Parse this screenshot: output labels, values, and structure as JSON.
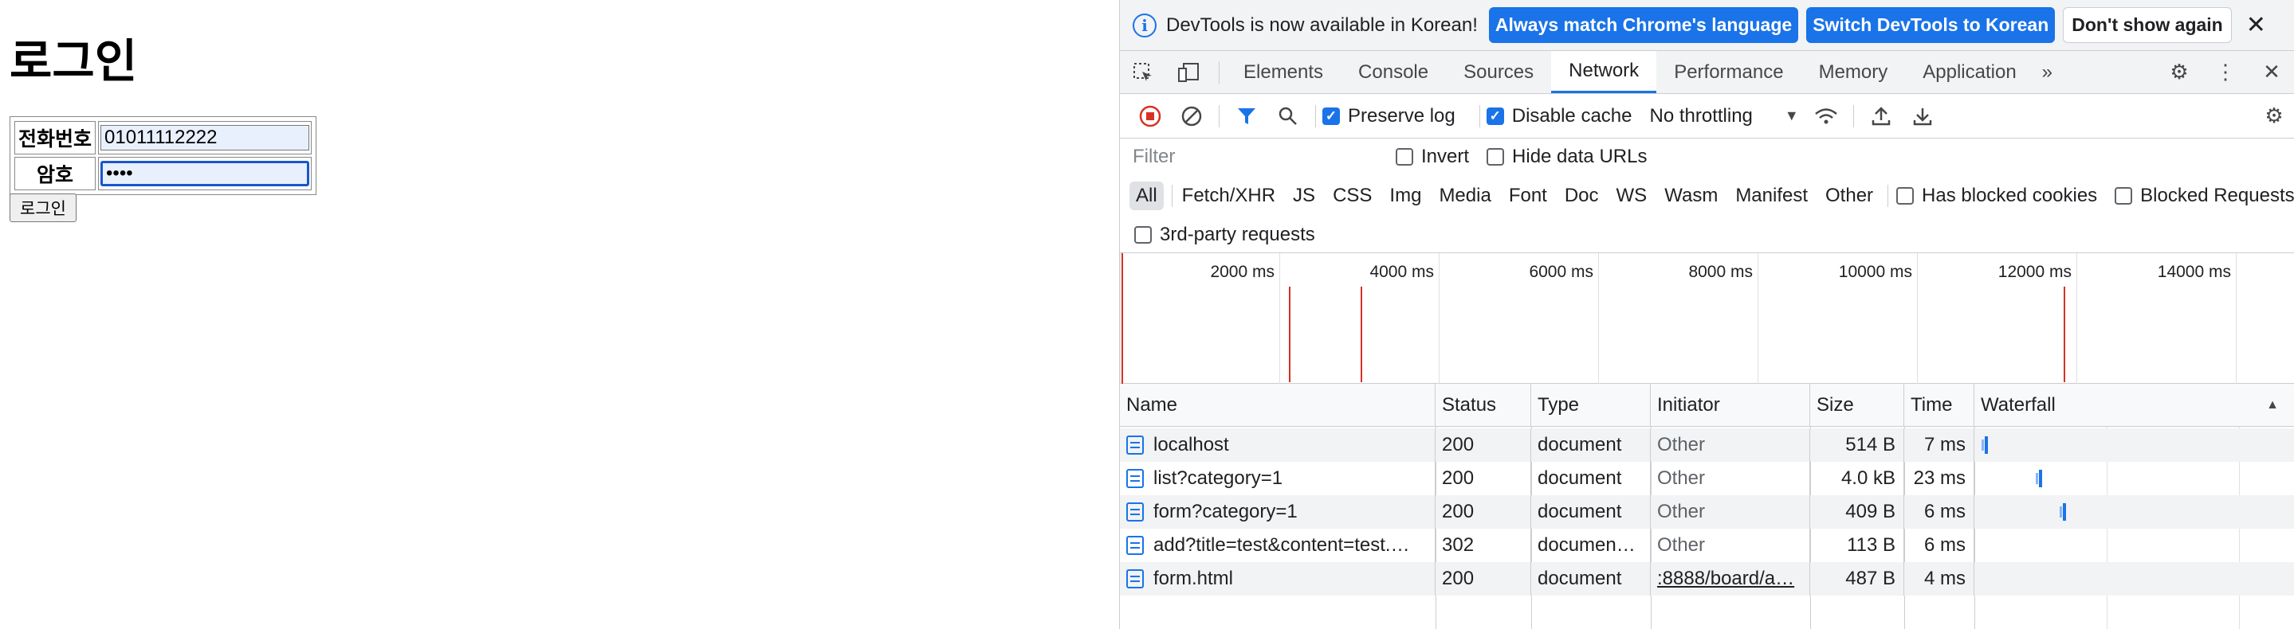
{
  "page": {
    "title": "로그인",
    "phone_label": "전화번호",
    "phone_value": "01011112222",
    "password_label": "암호",
    "password_value": "••••",
    "login_button": "로그인"
  },
  "devtools": {
    "infobar": {
      "message": "DevTools is now available in Korean!",
      "btn_match": "Always match Chrome's language",
      "btn_switch": "Switch DevTools to Korean",
      "btn_dismiss": "Don't show again",
      "close": "✕"
    },
    "tabs": [
      "Elements",
      "Console",
      "Sources",
      "Network",
      "Performance",
      "Memory",
      "Application"
    ],
    "active_tab": "Network",
    "more_tabs": "»",
    "toolbar": {
      "preserve_log": "Preserve log",
      "disable_cache": "Disable cache",
      "throttling": "No throttling"
    },
    "filter": {
      "placeholder": "Filter",
      "invert": "Invert",
      "hide_data_urls": "Hide data URLs"
    },
    "types": [
      "All",
      "Fetch/XHR",
      "JS",
      "CSS",
      "Img",
      "Media",
      "Font",
      "Doc",
      "WS",
      "Wasm",
      "Manifest",
      "Other"
    ],
    "has_blocked_cookies": "Has blocked cookies",
    "blocked_requests": "Blocked Requests",
    "third_party": "3rd-party requests",
    "overview_ticks": [
      "2000 ms",
      "4000 ms",
      "6000 ms",
      "8000 ms",
      "10000 ms",
      "12000 ms",
      "14000 ms"
    ],
    "columns": [
      "Name",
      "Status",
      "Type",
      "Initiator",
      "Size",
      "Time",
      "Waterfall"
    ],
    "rows": [
      {
        "name": "localhost",
        "status": "200",
        "type": "document",
        "initiator": "Other",
        "size": "514 B",
        "time": "7 ms"
      },
      {
        "name": "list?category=1",
        "status": "200",
        "type": "document",
        "initiator": "Other",
        "size": "4.0 kB",
        "time": "23 ms"
      },
      {
        "name": "form?category=1",
        "status": "200",
        "type": "document",
        "initiator": "Other",
        "size": "409 B",
        "time": "6 ms"
      },
      {
        "name": "add?title=test&content=test.…",
        "status": "302",
        "type": "documen…",
        "initiator": "Other",
        "size": "113 B",
        "time": "6 ms"
      },
      {
        "name": "form.html",
        "status": "200",
        "type": "document",
        "initiator": ":8888/board/a…",
        "size": "487 B",
        "time": "4 ms"
      }
    ]
  }
}
